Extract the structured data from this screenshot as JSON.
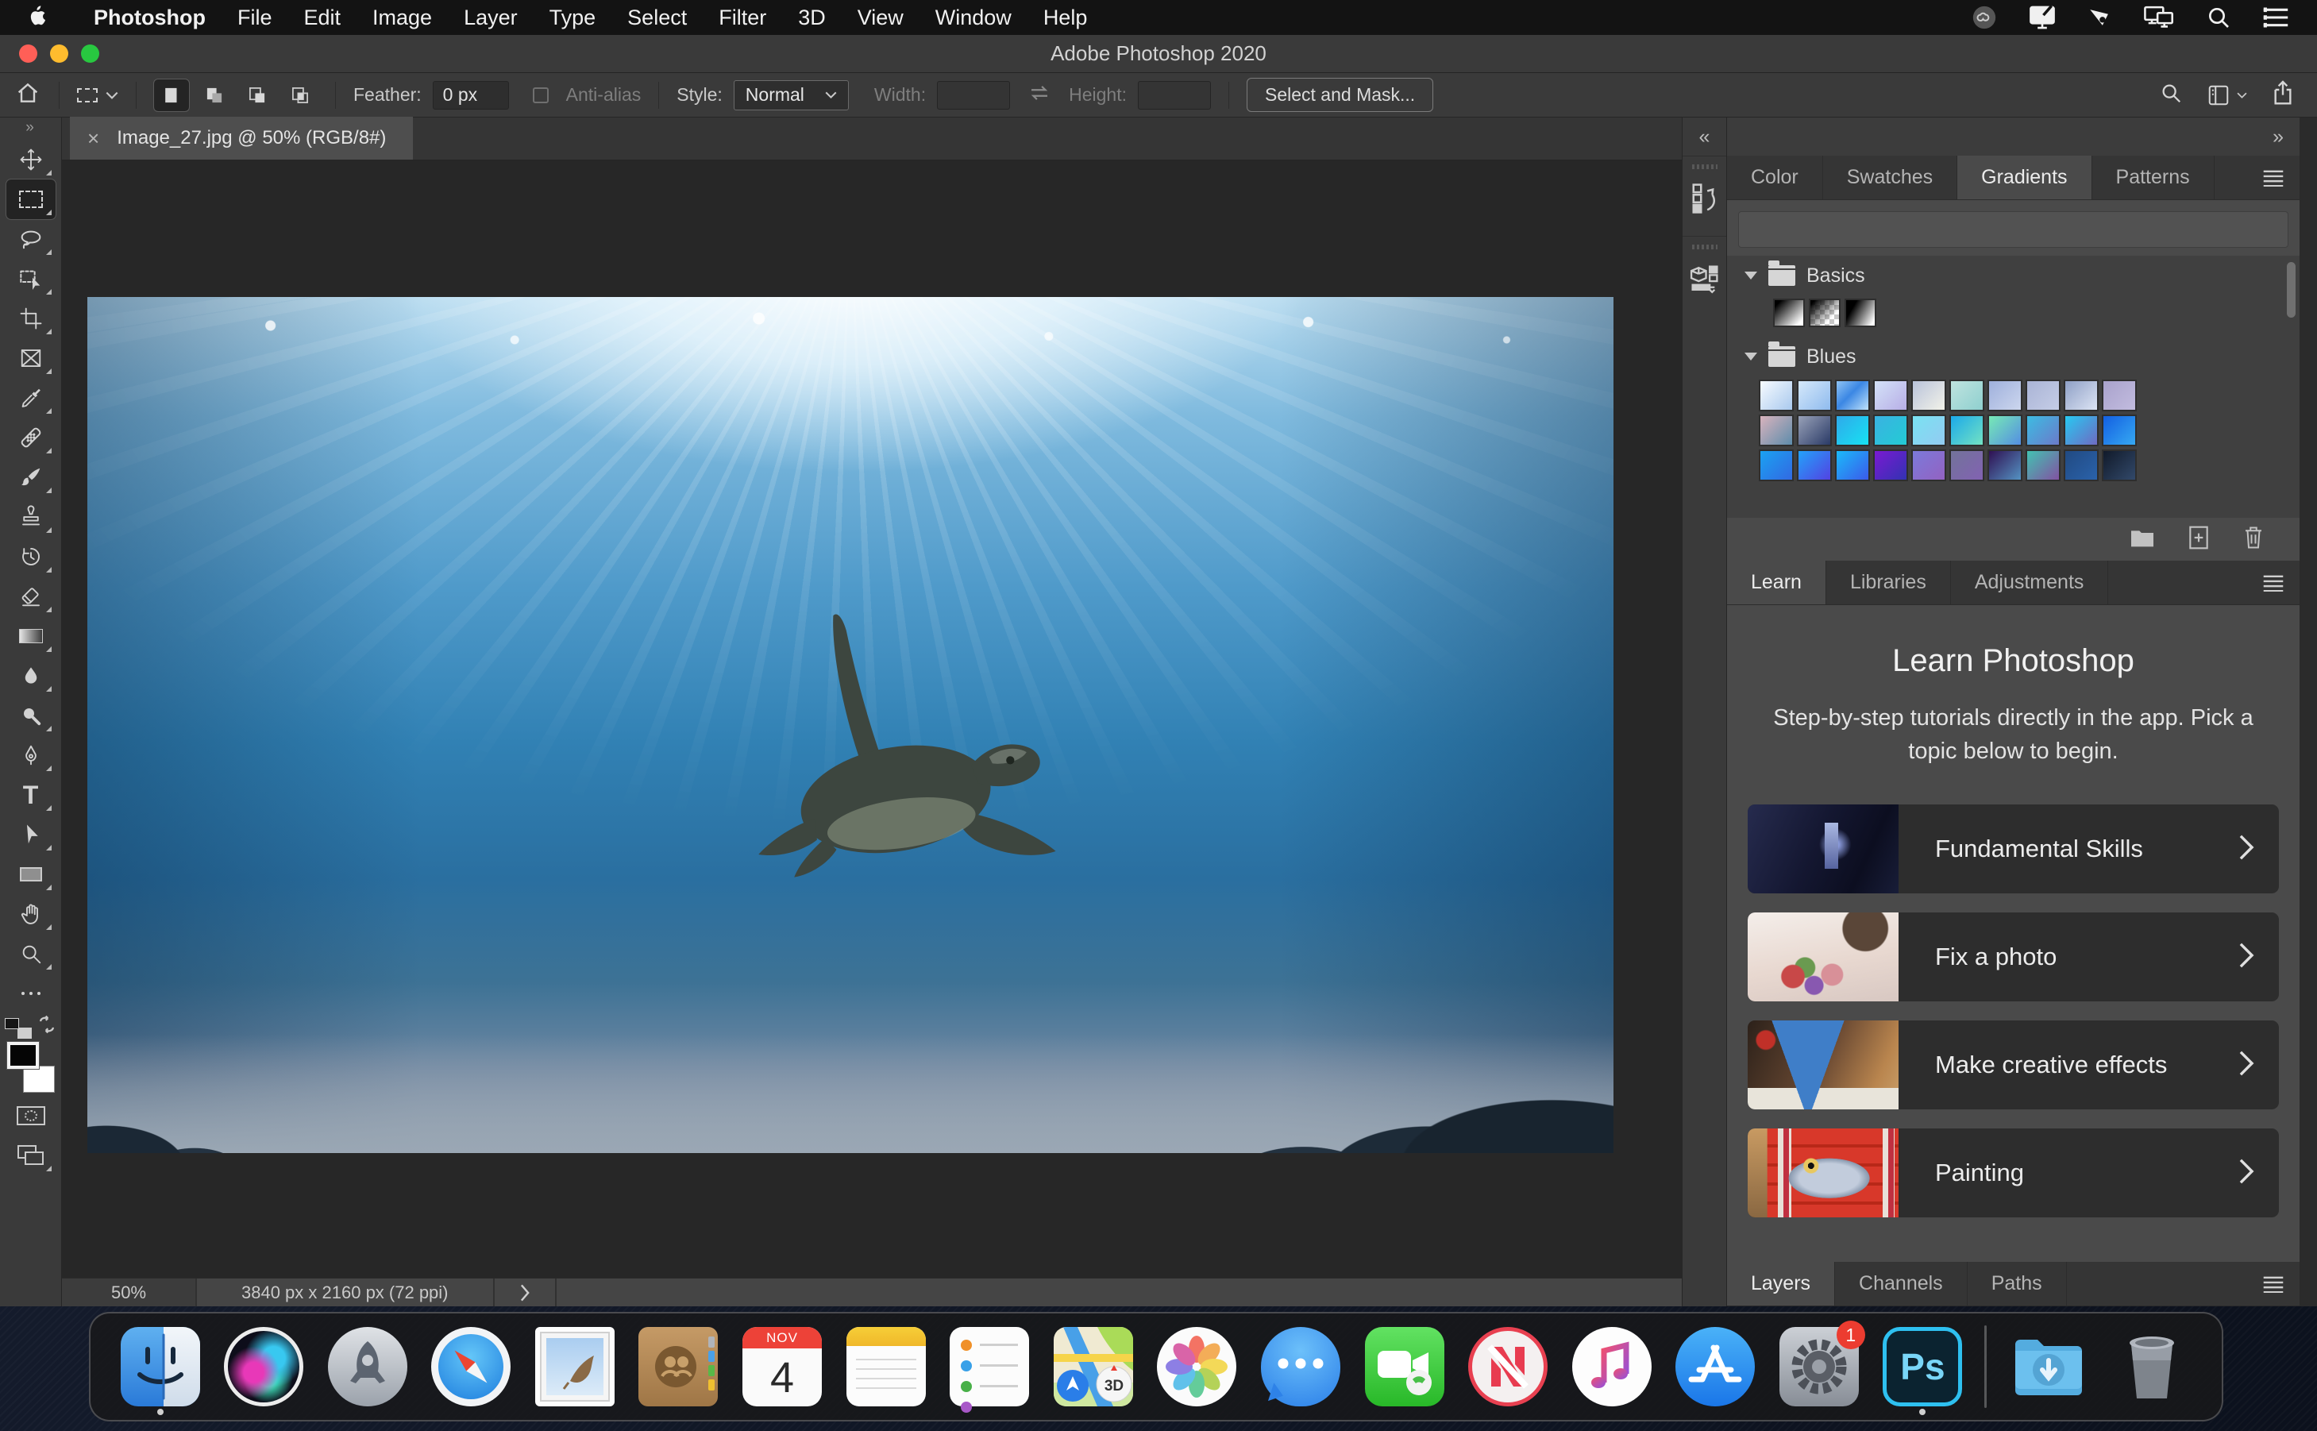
{
  "menubar": {
    "items": [
      "Photoshop",
      "File",
      "Edit",
      "Image",
      "Layer",
      "Type",
      "Select",
      "Filter",
      "3D",
      "View",
      "Window",
      "Help"
    ],
    "right_icons": [
      "creative-cloud",
      "sidecar-display",
      "pen-tablet",
      "dual-displays",
      "search",
      "menu-list"
    ]
  },
  "titlebar": {
    "title": "Adobe Photoshop 2020"
  },
  "options": {
    "feather_label": "Feather:",
    "feather_value": "0 px",
    "antialias_label": "Anti-alias",
    "style_label": "Style:",
    "style_value": "Normal",
    "width_label": "Width:",
    "swap_icon": "swap-width-height",
    "height_label": "Height:",
    "select_mask_label": "Select and Mask..."
  },
  "document_tab": {
    "close": "×",
    "title": "Image_27.jpg @ 50% (RGB/8#)"
  },
  "toolbar": {
    "header": "»",
    "tools": [
      "move",
      "rectangular-marquee",
      "lasso",
      "object-selection",
      "crop",
      "frame",
      "eyedropper",
      "spot-healing",
      "brush",
      "clone-stamp",
      "history-brush",
      "eraser",
      "gradient",
      "blur",
      "dodge",
      "pen",
      "type",
      "path-selection",
      "rectangle-shape",
      "hand",
      "zoom",
      "ellipsis"
    ],
    "selected": "rectangular-marquee"
  },
  "status": {
    "zoom": "50%",
    "dimensions": "3840 px x 2160 px (72 ppi)"
  },
  "panels": {
    "left_collapse": "«",
    "right_collapse": "»",
    "color_group": {
      "tabs": [
        "Color",
        "Swatches",
        "Gradients",
        "Patterns"
      ],
      "active": "Gradients"
    },
    "gradients": {
      "groups": [
        {
          "name": "Basics",
          "swatches": [
            "linear-gradient(135deg,#000 12%,#fff 88%)",
            "linear-gradient(135deg,#000 8%,rgba(255,255,255,0) 72%),repeating-conic-gradient(#ffffff 0% 25%,#c8c8c8 0% 50%) 0 0/12px 12px",
            "linear-gradient(120deg,#000 25%,#fff 92%)"
          ]
        },
        {
          "name": "Blues",
          "swatches": [
            "linear-gradient(135deg,#f7fbff,#a9c9ee)",
            "linear-gradient(135deg,#d5e8fa,#8fbbee)",
            "linear-gradient(135deg,#8fc3f4,#3b87e4 45%,#bfe2fa)",
            "linear-gradient(135deg,#d4e2f8,#b7aee6)",
            "linear-gradient(135deg,#b9c3da,#f2f2e9)",
            "linear-gradient(135deg,#bfe3df,#8fd0cf)",
            "linear-gradient(135deg,#9fb0dc,#ccd6ee)",
            "linear-gradient(135deg,#aab4d6,#c5cde6)",
            "linear-gradient(135deg,#8fa0c6,#dce4f4)",
            "linear-gradient(135deg,#a9a2cc,#c2bcdf)",
            "linear-gradient(135deg,#d9b3bd,#5d8cab)",
            "linear-gradient(135deg,#98a1b8,#2a3a66)",
            "linear-gradient(135deg,#2fa9ea,#17e2f2)",
            "linear-gradient(135deg,#3ab2e2,#23cbd4)",
            "linear-gradient(135deg,#79e2f2,#93cbf2)",
            "linear-gradient(135deg,#1ba9ea,#73e2c3)",
            "linear-gradient(135deg,#77eab5,#548ee2)",
            "linear-gradient(135deg,#3cbce2,#6b7aca)",
            "linear-gradient(135deg,#27c9f2,#6f6ac2)",
            "linear-gradient(135deg,#135fe2,#36a9f2)",
            "linear-gradient(135deg,#1aa2f2,#3269e2)",
            "linear-gradient(135deg,#23a2fa,#5242e2)",
            "linear-gradient(135deg,#1abafa,#3b5aea)",
            "linear-gradient(135deg,#7a1ad2,#3232b2)",
            "linear-gradient(135deg,#7b7ada,#9362c2)",
            "linear-gradient(135deg,#72739a,#8262b2)",
            "linear-gradient(135deg,#2f1052,#5492c2)",
            "linear-gradient(135deg,#42c2b2,#8252a2)",
            "linear-gradient(135deg,#214a82,#2a62aa)",
            "linear-gradient(135deg,#111a2a,#32496a)"
          ]
        }
      ],
      "actions": [
        "new-group",
        "new-gradient",
        "delete"
      ]
    },
    "learn_group": {
      "tabs": [
        "Learn",
        "Libraries",
        "Adjustments"
      ],
      "active": "Learn"
    },
    "learn": {
      "title": "Learn Photoshop",
      "subtitle": "Step-by-step tutorials directly in the app. Pick a topic below to begin.",
      "cards": [
        {
          "label": "Fundamental Skills",
          "thumb": "linear-gradient(180deg,#aab8e2,#56639f) 56% 42%/9% 52% no-repeat, radial-gradient(circle at 58% 45%, #8898d8 0 4%, rgba(40,50,100,0) 16%), linear-gradient(115deg,#262b4e 0%,#141731 45%,#0c0e20 75%,#181d38 100%)"
        },
        {
          "label": "Fix a photo",
          "thumb": "radial-gradient(circle at 78% 18%, #5a4638 0 16%, rgba(90,70,56,0) 17%), radial-gradient(circle at 30% 72%, #c84848 0 9%, rgba(200,72,72,0) 10%), radial-gradient(circle at 44% 82%, #8858b0 0 8%, rgba(136,88,176,0) 9%), radial-gradient(circle at 56% 70%, #d89098 0 10%, rgba(216,144,152,0) 11%), radial-gradient(circle at 38% 62%, #6a9a50 0 9%, rgba(106,154,80,0) 10%), linear-gradient(170deg,#f4eeea,#e8d8d0 55%,#d8c8c2)"
        },
        {
          "label": "Make creative effects",
          "thumb": "conic-gradient(from 340deg at 40% 112%, #3f7ec8 0 40deg, rgba(0,0,0,0) 40deg), linear-gradient(0deg, #e8e4da 0 24%, rgba(232,228,218,0) 24%), radial-gradient(circle at 12% 22%, #c03028 0 6%, rgba(192,48,40,0) 7%), radial-gradient(circle at 24% 10%, #a82820 0 5%, rgba(168,40,32,0) 6%), linear-gradient(115deg,#2c211a,#6b4a33 50%,#b9854e 82%,#caa06a)"
        },
        {
          "label": "Painting",
          "thumb": "radial-gradient(circle at 42% 42%, #111 0 4px, #e8c860 4px 9px, rgba(232,200,96,0) 10px), radial-gradient(ellipse 36% 30% at 54% 56%, #c2ccdc 0 55%, #8898ae 74%, rgba(136,152,174,0) 75%), repeating-linear-gradient(90deg, #e8e0d8 0 7px, #c03040 7px 14px) 22% 0/9% 100% no-repeat, repeating-linear-gradient(90deg,#e8e0d8 0 7px,#c03040 7px 14px) 97% 0/8% 100% no-repeat, linear-gradient(180deg,#c89a62,#8a6842) 0 0/13% 100% no-repeat, repeating-linear-gradient(180deg, #d8382a 0 20px, #b82818 20px 24px)"
        }
      ]
    },
    "layers_group": {
      "tabs": [
        "Layers",
        "Channels",
        "Paths"
      ],
      "active": "Layers"
    }
  },
  "dock": {
    "apps": [
      "Finder",
      "Siri",
      "Launchpad",
      "Safari",
      "Mail",
      "Contacts",
      "Calendar",
      "Notes",
      "Reminders",
      "Maps",
      "Photos",
      "Messages",
      "FaceTime",
      "News",
      "Music",
      "App Store",
      "System Preferences",
      "Photoshop",
      "Downloads",
      "Trash"
    ],
    "running": [
      "Finder",
      "Photoshop"
    ],
    "calendar_month": "NOV",
    "calendar_day": "4",
    "maps_badge": "3D",
    "prefs_badge": "1",
    "ps_label": "Ps"
  }
}
